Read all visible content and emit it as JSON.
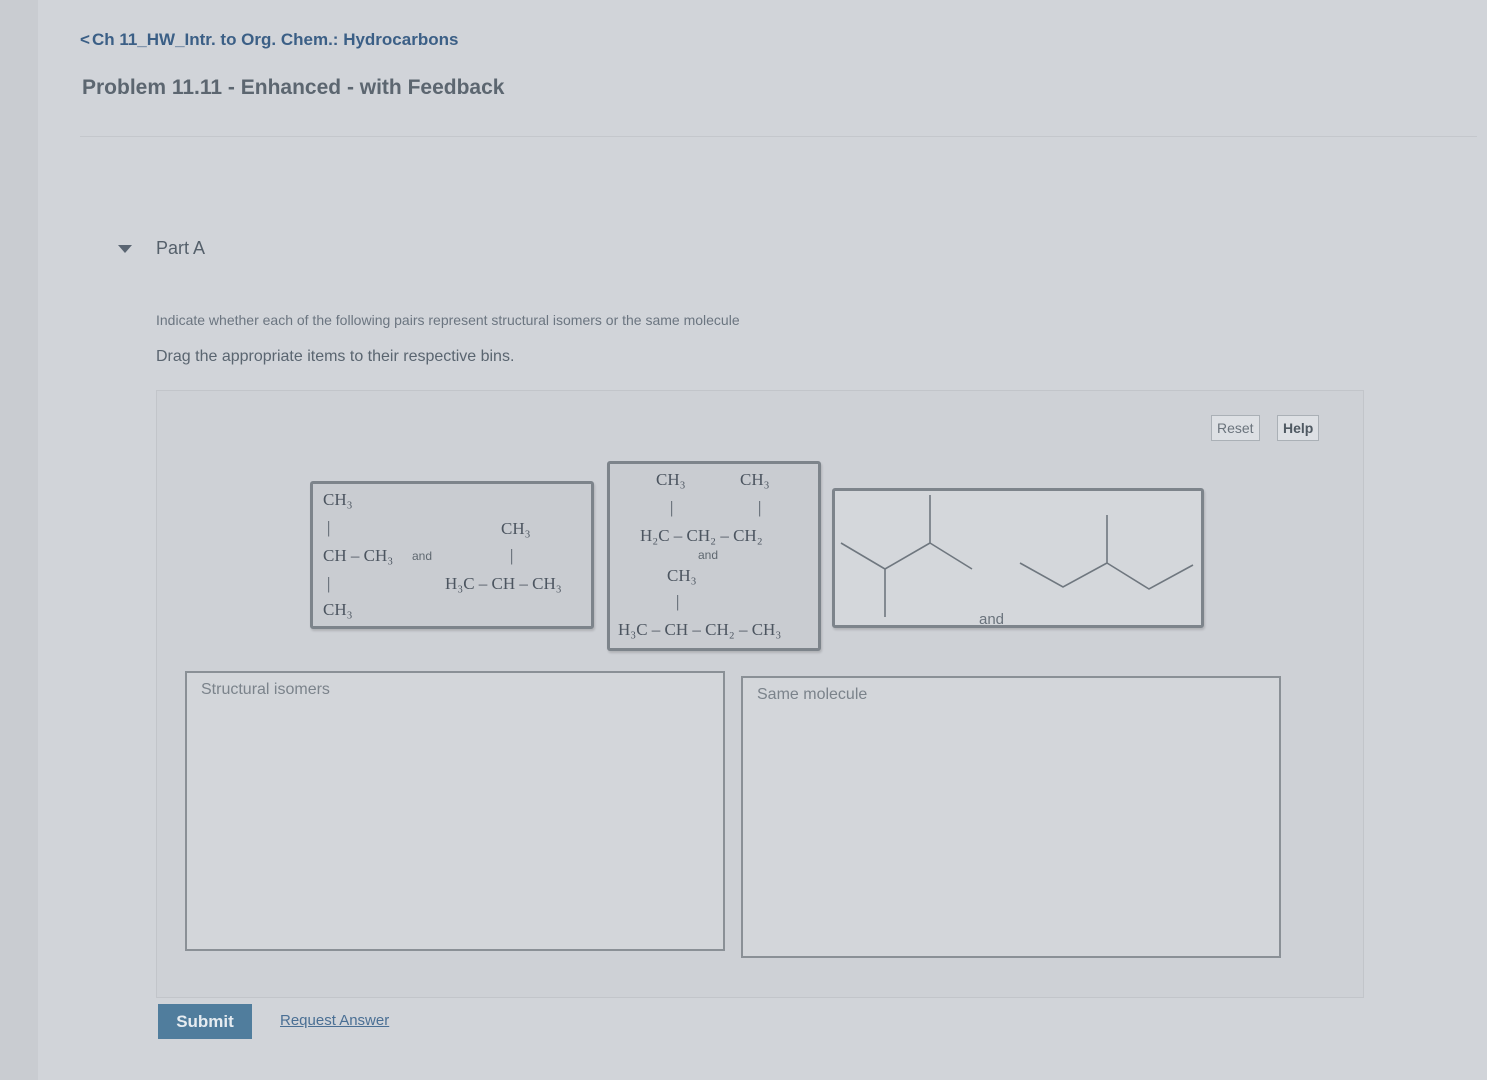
{
  "header": {
    "breadcrumb_chevron": "<",
    "breadcrumb": "Ch 11_HW_Intr. to Org. Chem.: Hydrocarbons",
    "problem_title": "Problem 11.11 - Enhanced - with Feedback"
  },
  "part": {
    "label": "Part A",
    "instructions": "Indicate whether each of the following pairs represent structural isomers or the same molecule",
    "drag_hint": "Drag the appropriate items to their respective bins."
  },
  "toolbar": {
    "reset_label": "Reset",
    "help_label": "Help"
  },
  "items": {
    "card1": {
      "left_top": "CH₃",
      "left_bar1": "|",
      "left_middle": "CH – CH₃",
      "and": "and",
      "left_bar2": "|",
      "left_bottom": "CH₃",
      "right_top": "CH₃",
      "right_bar": "|",
      "right_main": "H₃C – CH – CH₃"
    },
    "card2": {
      "top_left": "CH₃",
      "top_right": "CH₃",
      "bar_left": "|",
      "bar_right": "|",
      "main1": "H₂C – CH₂ – CH₂",
      "and": "and",
      "sub_top": "CH₃",
      "bar_sub": "|",
      "main2": "H₃C – CH – CH₂ – CH₃"
    },
    "card3": {
      "and": "and"
    }
  },
  "bins": {
    "structural": "Structural isomers",
    "same": "Same molecule"
  },
  "footer": {
    "submit_label": "Submit",
    "request_label": "Request Answer"
  }
}
